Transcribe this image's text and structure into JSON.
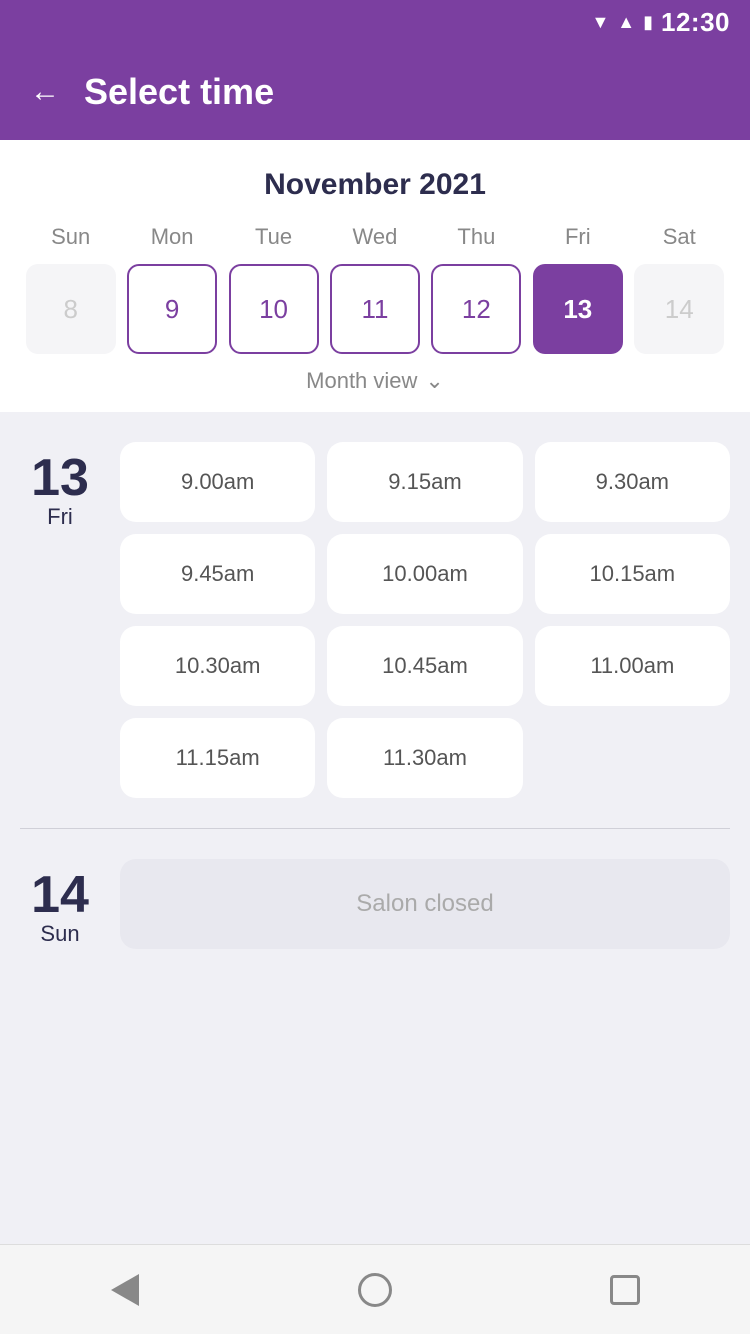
{
  "statusBar": {
    "time": "12:30"
  },
  "header": {
    "backLabel": "←",
    "title": "Select time"
  },
  "calendar": {
    "monthYear": "November 2021",
    "weekdays": [
      "Sun",
      "Mon",
      "Tue",
      "Wed",
      "Thu",
      "Fri",
      "Sat"
    ],
    "dates": [
      {
        "date": "8",
        "state": "inactive"
      },
      {
        "date": "9",
        "state": "active"
      },
      {
        "date": "10",
        "state": "active"
      },
      {
        "date": "11",
        "state": "active"
      },
      {
        "date": "12",
        "state": "active"
      },
      {
        "date": "13",
        "state": "selected"
      },
      {
        "date": "14",
        "state": "inactive"
      }
    ],
    "monthViewLabel": "Month view"
  },
  "schedule": {
    "days": [
      {
        "dayNumber": "13",
        "dayName": "Fri",
        "slots": [
          "9.00am",
          "9.15am",
          "9.30am",
          "9.45am",
          "10.00am",
          "10.15am",
          "10.30am",
          "10.45am",
          "11.00am",
          "11.15am",
          "11.30am"
        ],
        "closed": false
      },
      {
        "dayNumber": "14",
        "dayName": "Sun",
        "slots": [],
        "closed": true,
        "closedMessage": "Salon closed"
      }
    ]
  },
  "bottomNav": {
    "back": "back",
    "home": "home",
    "recents": "recents"
  }
}
